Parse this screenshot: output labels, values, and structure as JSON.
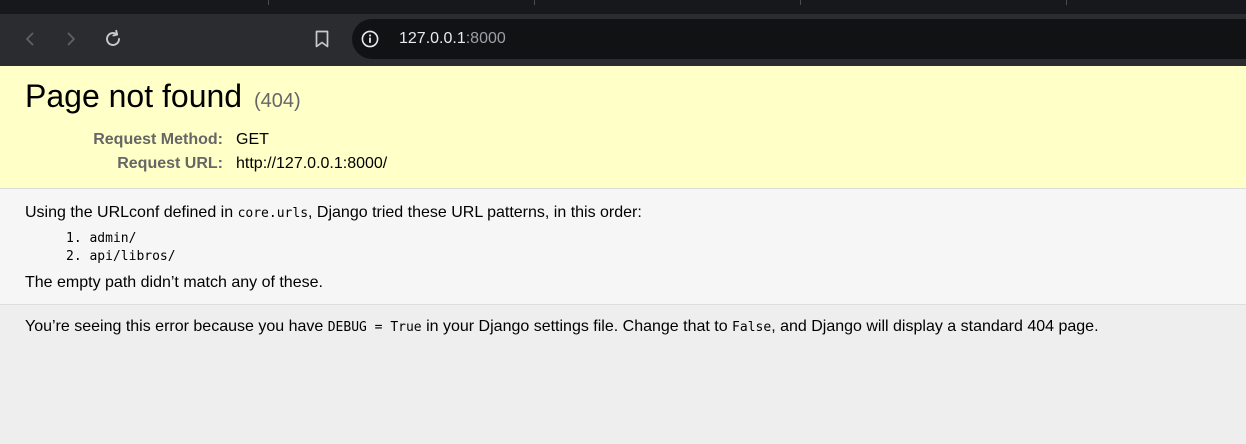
{
  "browser": {
    "url_host": "127.0.0.1",
    "url_port": ":8000",
    "icons": {
      "back": "back-arrow-icon",
      "forward": "forward-arrow-icon",
      "reload": "reload-icon",
      "bookmark": "bookmark-icon",
      "site_info": "info-icon"
    }
  },
  "page": {
    "title": "Page not found",
    "status_code": "(404)",
    "request_method_label": "Request Method:",
    "request_method_value": "GET",
    "request_url_label": "Request URL:",
    "request_url_value": "http://127.0.0.1:8000/",
    "urlconf_prefix": "Using the URLconf defined in ",
    "urlconf_module": "core.urls",
    "urlconf_suffix": ", Django tried these URL patterns, in this order:",
    "patterns": [
      {
        "index": "1.",
        "pattern": "admin/"
      },
      {
        "index": "2.",
        "pattern": "api/libros/"
      }
    ],
    "no_match": "The empty path didn’t match any of these.",
    "explanation": {
      "part1": "You’re seeing this error because you have ",
      "debug_setting": "DEBUG = True",
      "part2": " in your Django settings file. Change that to ",
      "false_value": "False",
      "part3": ", and Django will display a standard 404 page."
    }
  },
  "colors": {
    "summary_bg": "#ffffc8",
    "info_bg": "#f6f6f6",
    "explanation_bg": "#eeeeee",
    "chrome_toolbar": "#2b2c30",
    "omnibox_bg": "#111214"
  }
}
